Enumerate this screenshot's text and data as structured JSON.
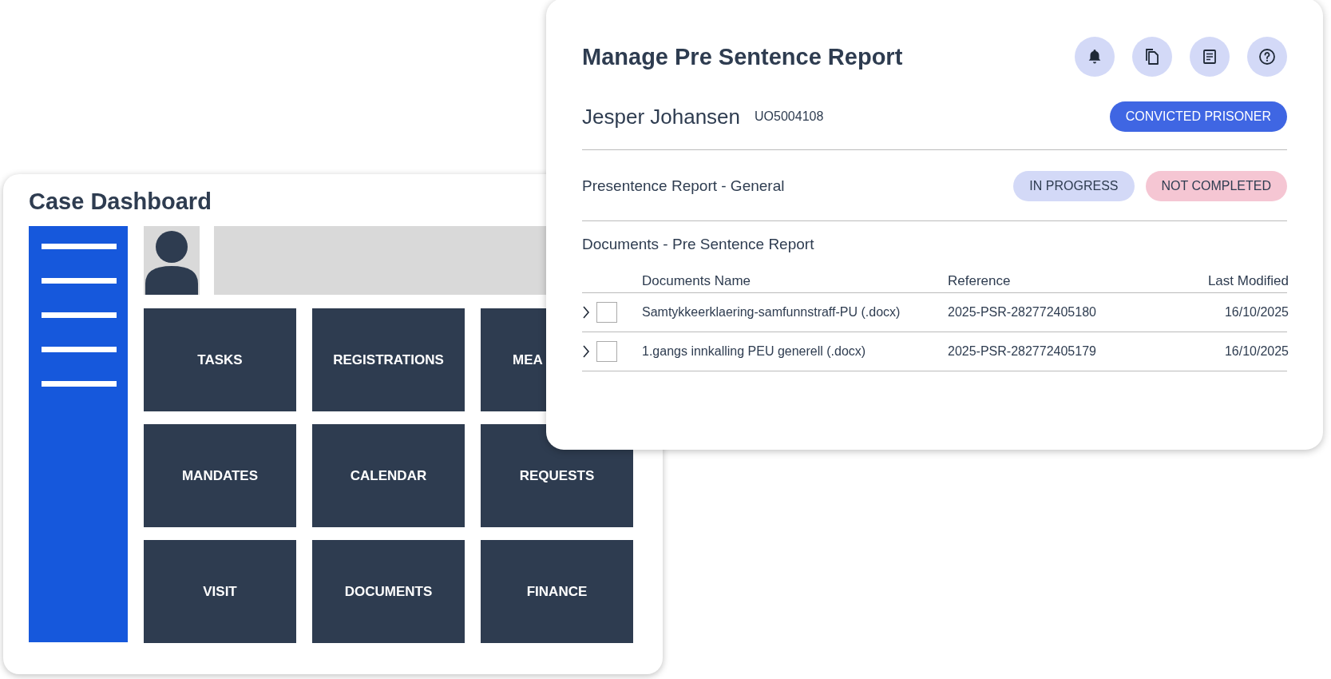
{
  "dashboard": {
    "title": "Case Dashboard",
    "tiles": [
      {
        "label": "TASKS"
      },
      {
        "label": "REGISTRATIONS"
      },
      {
        "label": "MEA",
        "partial": true
      },
      {
        "label": "MANDATES"
      },
      {
        "label": "CALENDAR"
      },
      {
        "label": "REQUESTS"
      },
      {
        "label": "VISIT"
      },
      {
        "label": "DOCUMENTS"
      },
      {
        "label": "FINANCE"
      }
    ]
  },
  "panel": {
    "title": "Manage Pre Sentence Report",
    "actions": [
      {
        "kind": "bell"
      },
      {
        "kind": "copy"
      },
      {
        "kind": "document"
      },
      {
        "kind": "help"
      }
    ],
    "person": {
      "name": "Jesper Johansen",
      "id": "UO5004108",
      "badge": "CONVICTED PRISONER"
    },
    "report": {
      "title": "Presentence Report - General",
      "chips": [
        {
          "label": "IN PROGRESS",
          "kind": "progress"
        },
        {
          "label": "NOT COMPLETED",
          "kind": "incomplete"
        }
      ]
    },
    "documents": {
      "title": "Documents - Pre Sentence Report",
      "columns": [
        "Documents Name",
        "Reference",
        "Last Modified"
      ],
      "rows": [
        {
          "expanded": false,
          "checked": false,
          "cells": [
            "Samtykkeerklaering-samfunnstraff-PU (.docx)",
            "2025-PSR-282772405180",
            "16/10/2025"
          ]
        },
        {
          "expanded": false,
          "checked": false,
          "cells": [
            "1.gangs innkalling PEU generell (.docx)",
            "2025-PSR-282772405179",
            "16/10/2025"
          ]
        }
      ]
    }
  }
}
